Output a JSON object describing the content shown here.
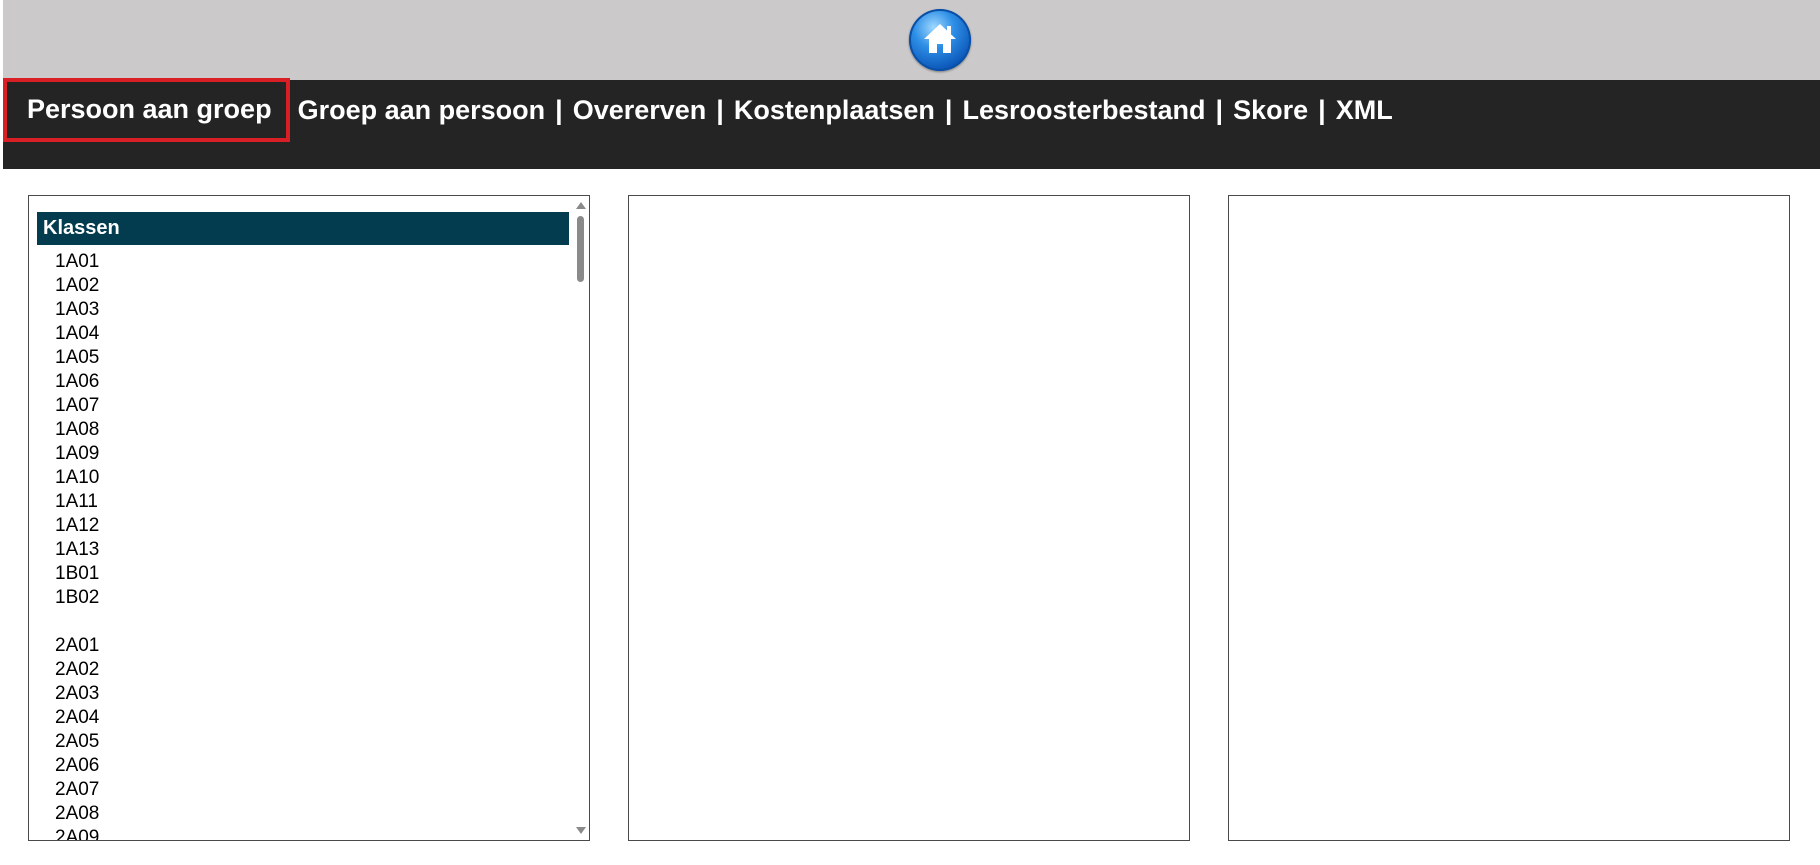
{
  "header": {
    "home_icon": "home-icon"
  },
  "nav": {
    "items": [
      "Persoon aan groep",
      "Groep aan persoon",
      "Overerven",
      "Kostenplaatsen",
      "Lesroosterbestand",
      "Skore",
      "XML"
    ],
    "separator": "|",
    "active_index": 0,
    "active_color": "#d81f26"
  },
  "left_panel": {
    "header": "Klassen",
    "classes_group1": [
      "1A01",
      "1A02",
      "1A03",
      "1A04",
      "1A05",
      "1A06",
      "1A07",
      "1A08",
      "1A09",
      "1A10",
      "1A11",
      "1A12",
      "1A13",
      "1B01",
      "1B02"
    ],
    "classes_group2": [
      "2A01",
      "2A02",
      "2A03",
      "2A04",
      "2A05",
      "2A06",
      "2A07",
      "2A08",
      "2A09"
    ]
  },
  "colors": {
    "topbar": "#cbc9ca",
    "navbar": "#242424",
    "list_header": "#033b4f"
  }
}
